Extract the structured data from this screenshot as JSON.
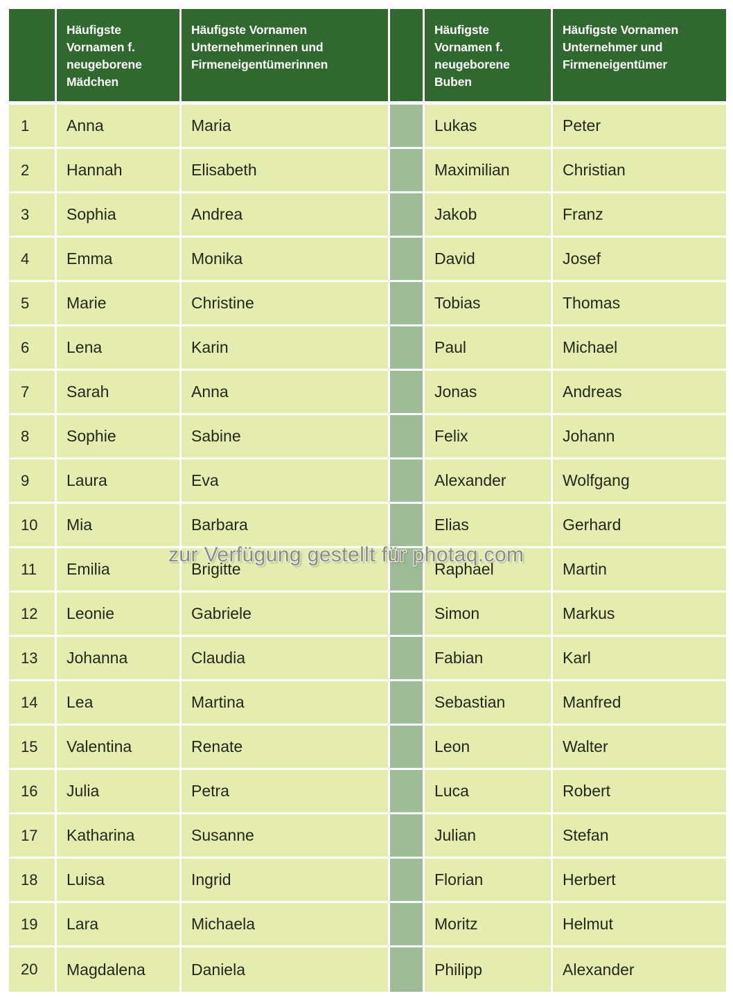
{
  "table": {
    "columns": [
      {
        "key": "rank",
        "header": ""
      },
      {
        "key": "girls",
        "header": "Häufigste Vornamen f. neugeborene Mädchen"
      },
      {
        "key": "women_owners",
        "header": "Häufigste Vornamen Unternehmerinnen und Firmeneigentümerinnen"
      },
      {
        "key": "separator",
        "header": ""
      },
      {
        "key": "boys",
        "header": "Häufigste Vornamen f. neugeborene Buben"
      },
      {
        "key": "men_owners",
        "header": "Häufigste Vornamen Unternehmer und Firmeneigentümer"
      }
    ],
    "rows": [
      {
        "rank": "1",
        "girls": "Anna",
        "women_owners": "Maria",
        "boys": "Lukas",
        "men_owners": "Peter"
      },
      {
        "rank": "2",
        "girls": "Hannah",
        "women_owners": "Elisabeth",
        "boys": "Maximilian",
        "men_owners": "Christian"
      },
      {
        "rank": "3",
        "girls": "Sophia",
        "women_owners": "Andrea",
        "boys": "Jakob",
        "men_owners": "Franz"
      },
      {
        "rank": "4",
        "girls": "Emma",
        "women_owners": "Monika",
        "boys": "David",
        "men_owners": "Josef"
      },
      {
        "rank": "5",
        "girls": "Marie",
        "women_owners": "Christine",
        "boys": "Tobias",
        "men_owners": "Thomas"
      },
      {
        "rank": "6",
        "girls": "Lena",
        "women_owners": "Karin",
        "boys": "Paul",
        "men_owners": "Michael"
      },
      {
        "rank": "7",
        "girls": "Sarah",
        "women_owners": "Anna",
        "boys": "Jonas",
        "men_owners": "Andreas"
      },
      {
        "rank": "8",
        "girls": "Sophie",
        "women_owners": "Sabine",
        "boys": "Felix",
        "men_owners": "Johann"
      },
      {
        "rank": "9",
        "girls": "Laura",
        "women_owners": "Eva",
        "boys": "Alexander",
        "men_owners": "Wolfgang"
      },
      {
        "rank": "10",
        "girls": "Mia",
        "women_owners": "Barbara",
        "boys": "Elias",
        "men_owners": "Gerhard"
      },
      {
        "rank": "11",
        "girls": "Emilia",
        "women_owners": "Brigitte",
        "boys": "Raphael",
        "men_owners": "Martin"
      },
      {
        "rank": "12",
        "girls": "Leonie",
        "women_owners": "Gabriele",
        "boys": "Simon",
        "men_owners": "Markus"
      },
      {
        "rank": "13",
        "girls": "Johanna",
        "women_owners": "Claudia",
        "boys": "Fabian",
        "men_owners": "Karl"
      },
      {
        "rank": "14",
        "girls": "Lea",
        "women_owners": "Martina",
        "boys": "Sebastian",
        "men_owners": "Manfred"
      },
      {
        "rank": "15",
        "girls": "Valentina",
        "women_owners": "Renate",
        "boys": "Leon",
        "men_owners": "Walter"
      },
      {
        "rank": "16",
        "girls": "Julia",
        "women_owners": "Petra",
        "boys": "Luca",
        "men_owners": "Robert"
      },
      {
        "rank": "17",
        "girls": "Katharina",
        "women_owners": "Susanne",
        "boys": "Julian",
        "men_owners": "Stefan"
      },
      {
        "rank": "18",
        "girls": "Luisa",
        "women_owners": "Ingrid",
        "boys": "Florian",
        "men_owners": "Herbert"
      },
      {
        "rank": "19",
        "girls": "Lara",
        "women_owners": "Michaela",
        "boys": "Moritz",
        "men_owners": "Helmut"
      },
      {
        "rank": "20",
        "girls": "Magdalena",
        "women_owners": "Daniela",
        "boys": "Philipp",
        "men_owners": "Alexander"
      }
    ]
  },
  "watermark": {
    "text": "zur Verfügung gestellt für photaq.com"
  },
  "colors": {
    "header_green": "#31682F",
    "body_cell": "#E4EDAF",
    "separator_column": "#9DBB97",
    "gridline": "#FFFFFF",
    "header_text": "#FFFFFF",
    "body_text": "#262617",
    "watermark_text": "#8C8C86",
    "page_background": "#FFFFFF"
  }
}
